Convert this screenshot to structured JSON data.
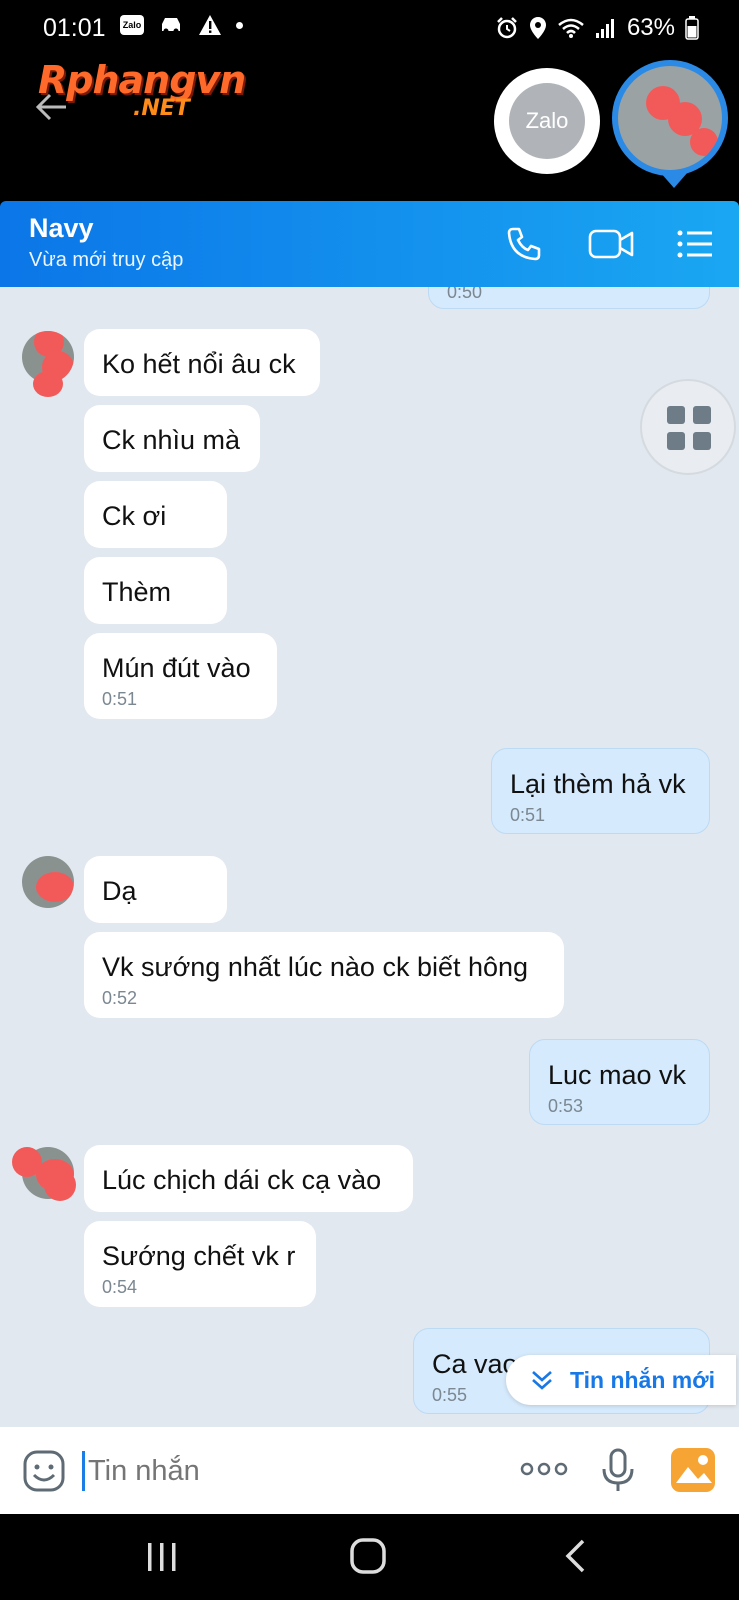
{
  "status_bar": {
    "time": "01:01",
    "zalo_icon": "Zalo",
    "battery": "63%"
  },
  "banner": {
    "logo_main": "Rphangvn",
    "logo_sub": ".NET",
    "zalo_label": "Zalo"
  },
  "header": {
    "contact_name": "Navy",
    "contact_status": "Vừa mới truy cập"
  },
  "messages": [
    {
      "side": "me",
      "text": "",
      "time": "0:50"
    },
    {
      "side": "them",
      "text": "Ko hết nổi âu ck",
      "time": ""
    },
    {
      "side": "them",
      "text": "Ck nhìu mà",
      "time": ""
    },
    {
      "side": "them",
      "text": "Ck ơi",
      "time": ""
    },
    {
      "side": "them",
      "text": "Thèm",
      "time": ""
    },
    {
      "side": "them",
      "text": "Mún đút vào",
      "time": "0:51"
    },
    {
      "side": "me",
      "text": "Lại thèm hả vk",
      "time": "0:51"
    },
    {
      "side": "them",
      "text": "Dạ",
      "time": ""
    },
    {
      "side": "them",
      "text": "Vk sướng nhất lúc nào ck biết hông",
      "time": "0:52"
    },
    {
      "side": "me",
      "text": "Luc mao vk",
      "time": "0:53"
    },
    {
      "side": "them",
      "text": "Lúc chịch dái ck cạ vào",
      "time": ""
    },
    {
      "side": "them",
      "text": "Sướng chết vk r",
      "time": "0:54"
    },
    {
      "side": "me",
      "text": "Ca vao",
      "time": "0:55"
    }
  ],
  "new_messages_button": "Tin nhắn mới",
  "input": {
    "placeholder": "Tin nhắn"
  },
  "colors": {
    "header_start": "#0b76e8",
    "header_end": "#1aa7f2",
    "chat_bg": "#e2e8ef",
    "my_bubble": "#d5eafc",
    "accent": "#1778e6"
  },
  "icons": {
    "header": [
      "phone-icon",
      "video-call-icon",
      "menu-list-icon"
    ],
    "input": [
      "sticker-icon",
      "more-icon",
      "microphone-icon",
      "image-icon"
    ],
    "nav": [
      "recent-apps-icon",
      "home-icon",
      "back-icon"
    ]
  }
}
